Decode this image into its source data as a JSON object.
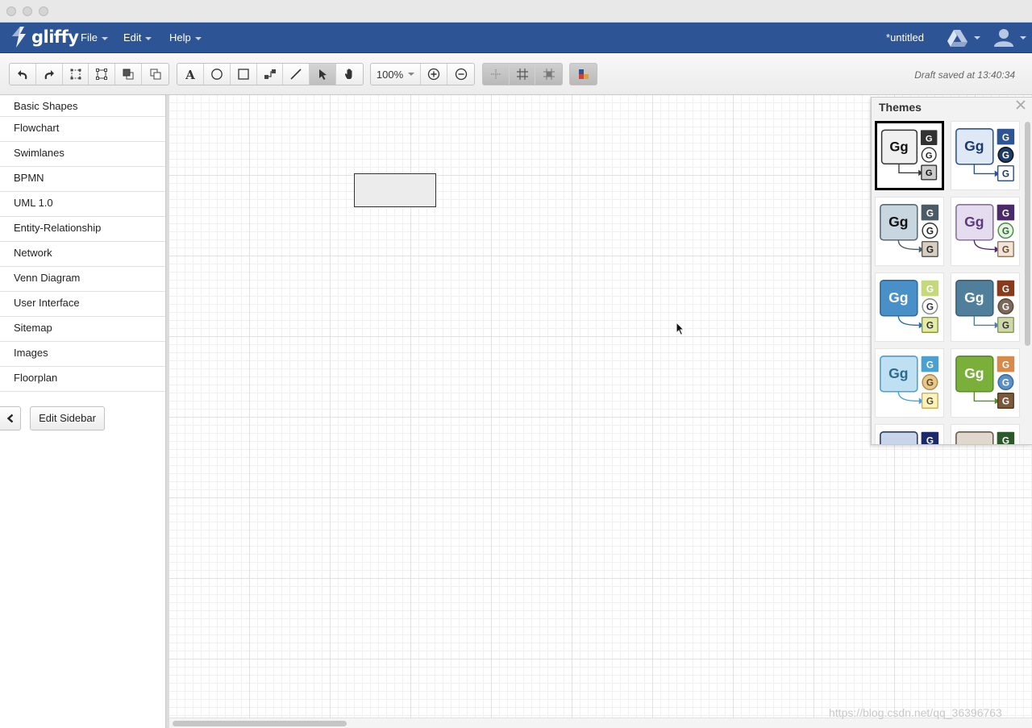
{
  "menubar": {
    "logo": "gliffy",
    "menus": [
      "File",
      "Edit",
      "Help"
    ],
    "document_title": "*untitled"
  },
  "toolbar": {
    "zoom": "100%",
    "status": "Draft saved at 13:40:34"
  },
  "sidebar": {
    "categories": [
      "Basic Shapes",
      "Flowchart",
      "Swimlanes",
      "BPMN",
      "UML 1.0",
      "Entity-Relationship",
      "Network",
      "Venn Diagram",
      "User Interface",
      "Sitemap",
      "Images",
      "Floorplan"
    ],
    "edit_button": "Edit Sidebar"
  },
  "themes": {
    "title": "Themes",
    "sample_big": "Gg",
    "sample_small": "G",
    "selected": 0,
    "tiles": [
      {
        "main_fill": "#f0f0f0",
        "main_stroke": "#333333",
        "text": "#111111",
        "c1": "#333333",
        "c2fill": "#ffffff",
        "c2stroke": "#333333",
        "c2text": "#222222",
        "c3fill": "#cccccc",
        "c3stroke": "#333333",
        "c3text": "#111111",
        "line": "#333333",
        "elbow": true
      },
      {
        "main_fill": "#dfe8f5",
        "main_stroke": "#2d5595",
        "text": "#1d3a6a",
        "c1": "#2d5595",
        "c2fill": "#1d3a6a",
        "c2stroke": "#111111",
        "c2text": "#ffffff",
        "c3fill": "#ffffff",
        "c3stroke": "#2d5595",
        "c3text": "#1d3a6a",
        "line": "#2d5595",
        "elbow": true
      },
      {
        "main_fill": "#c8d6e0",
        "main_stroke": "#5a6b78",
        "text": "#111111",
        "c1": "#4a5a66",
        "c2fill": "#ffffff",
        "c2stroke": "#333333",
        "c2text": "#222222",
        "c3fill": "#d8cfc0",
        "c3stroke": "#5a5a5a",
        "c3text": "#222222",
        "line": "#4a5a66",
        "elbow": false
      },
      {
        "main_fill": "#e6dcef",
        "main_stroke": "#8a6fa0",
        "text": "#5a3a7a",
        "c1": "#4a2a6a",
        "c2fill": "#e7f2e4",
        "c2stroke": "#4a8a4a",
        "c2text": "#2e6a2e",
        "c3fill": "#f1e4d8",
        "c3stroke": "#9a7a5a",
        "c3text": "#6a4a2a",
        "line": "#4a2a6a",
        "elbow": false
      },
      {
        "main_fill": "#4a90c8",
        "main_stroke": "#2e6aa0",
        "text": "#ffffff",
        "c1": "#c6d97a",
        "c2fill": "#ffffff",
        "c2stroke": "#888888",
        "c2text": "#333333",
        "c3fill": "#e4eca8",
        "c3stroke": "#8a9a3a",
        "c3text": "#333333",
        "line": "#2e6aa0",
        "elbow": false
      },
      {
        "main_fill": "#4f7f9b",
        "main_stroke": "#3a6078",
        "text": "#ffffff",
        "c1": "#8a3a1a",
        "c2fill": "#7a6a5a",
        "c2stroke": "#5a4a3a",
        "c2text": "#ffffff",
        "c3fill": "#cfd8a8",
        "c3stroke": "#8a9a5a",
        "c3text": "#333333",
        "line": "#4f7f9b",
        "elbow": true
      },
      {
        "main_fill": "#bfe0f2",
        "main_stroke": "#4aa0d0",
        "text": "#2a6a90",
        "c1": "#4aa0d0",
        "c2fill": "#e8c88a",
        "c2stroke": "#b08a4a",
        "c2text": "#5a4a2a",
        "c3fill": "#fff4c0",
        "c3stroke": "#d0b04a",
        "c3text": "#5a4a2a",
        "line": "#4aa0d0",
        "elbow": false
      },
      {
        "main_fill": "#7ab03a",
        "main_stroke": "#5a8a2a",
        "text": "#ffffff",
        "c1": "#d88a4a",
        "c2fill": "#5a90c8",
        "c2stroke": "#3a6aa0",
        "c2text": "#ffffff",
        "c3fill": "#7a5a3a",
        "c3stroke": "#5a3a1a",
        "c3text": "#ffffff",
        "line": "#5a8a2a",
        "elbow": true
      },
      {
        "main_fill": "#c8d4e8",
        "main_stroke": "#2a3a6a",
        "text": "#1a2a5a",
        "c1": "#1a2a6a",
        "c2fill": "#ffffff",
        "c2stroke": "#333333",
        "c2text": "#222222",
        "c3fill": "#ffffff",
        "c3stroke": "#333333",
        "c3text": "#222222",
        "line": "#1a2a6a",
        "elbow": false
      },
      {
        "main_fill": "#e0d8cc",
        "main_stroke": "#6a5a4a",
        "text": "#3a2a1a",
        "c1": "#2a5a2a",
        "c2fill": "#ffffff",
        "c2stroke": "#333333",
        "c2text": "#222222",
        "c3fill": "#ffffff",
        "c3stroke": "#333333",
        "c3text": "#222222",
        "line": "#2a5a2a",
        "elbow": false
      }
    ]
  },
  "watermark": "https://blog.csdn.net/qq_36396763",
  "colors": {
    "menubar": "#2d5595",
    "canvas_grid": "#dde1ec"
  }
}
